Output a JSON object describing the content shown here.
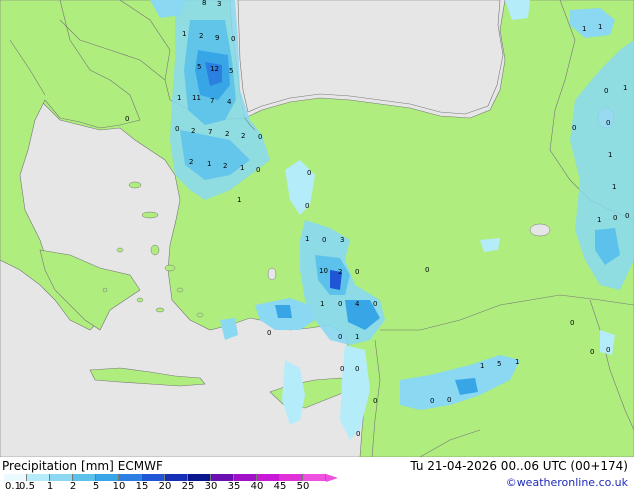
{
  "legend": {
    "title": "Precipitation",
    "unit": "[mm]",
    "model": "ECMWF",
    "ticks": [
      "0.1",
      "0.5",
      "1",
      "2",
      "5",
      "10",
      "15",
      "20",
      "25",
      "30",
      "35",
      "40",
      "45",
      "50"
    ],
    "colors": [
      "#eafaff",
      "#b5ecfa",
      "#8ad8f2",
      "#5cc2eb",
      "#38a6e6",
      "#2a7fe0",
      "#1f56d6",
      "#1530b5",
      "#0a168c",
      "#6b10b0",
      "#a010c8",
      "#c81ad6",
      "#e030d8",
      "#f050e0"
    ]
  },
  "datetime": "Tu 21-04-2026 00..06 UTC (00+174)",
  "credit": "©weatheronline.co.uk",
  "colors": {
    "sea": "#e6e6e6",
    "land": "#aeed7e",
    "border": "#777777"
  },
  "map_labels": {
    "l1": "8",
    "l2": "3",
    "l3": "1",
    "l4": "2",
    "l5": "9",
    "l6": "0",
    "l7": "5",
    "l8": "12",
    "l9": "5",
    "l10": "1",
    "l11": "11",
    "l12": "7",
    "l13": "4",
    "l14": "0",
    "l15": "2",
    "l16": "7",
    "l17": "2",
    "l18": "2",
    "l19": "0",
    "l20": "2",
    "l21": "1",
    "l22": "2",
    "l23": "1",
    "l24": "0",
    "l25": "1",
    "l26": "0",
    "l27": "0",
    "l28": "1",
    "l29": "0",
    "l30": "3",
    "l31": "10",
    "l32": "2",
    "l33": "0",
    "l34": "1",
    "l35": "0",
    "l36": "4",
    "l37": "0",
    "l38": "0",
    "l39": "1",
    "l40": "0",
    "l41": "0",
    "l42": "0",
    "l43": "0",
    "l44": "0",
    "l45": "1",
    "l46": "5",
    "l47": "1",
    "l48": "0",
    "l49": "0",
    "l50": "0",
    "l51": "1",
    "l52": "1",
    "l53": "0",
    "l54": "0",
    "l55": "0",
    "l56": "1",
    "l57": "1",
    "l58": "1",
    "l59": "0",
    "l60": "1",
    "l61": "0",
    "l62": "0",
    "l63": "0",
    "l64": "0",
    "l65": "0"
  }
}
